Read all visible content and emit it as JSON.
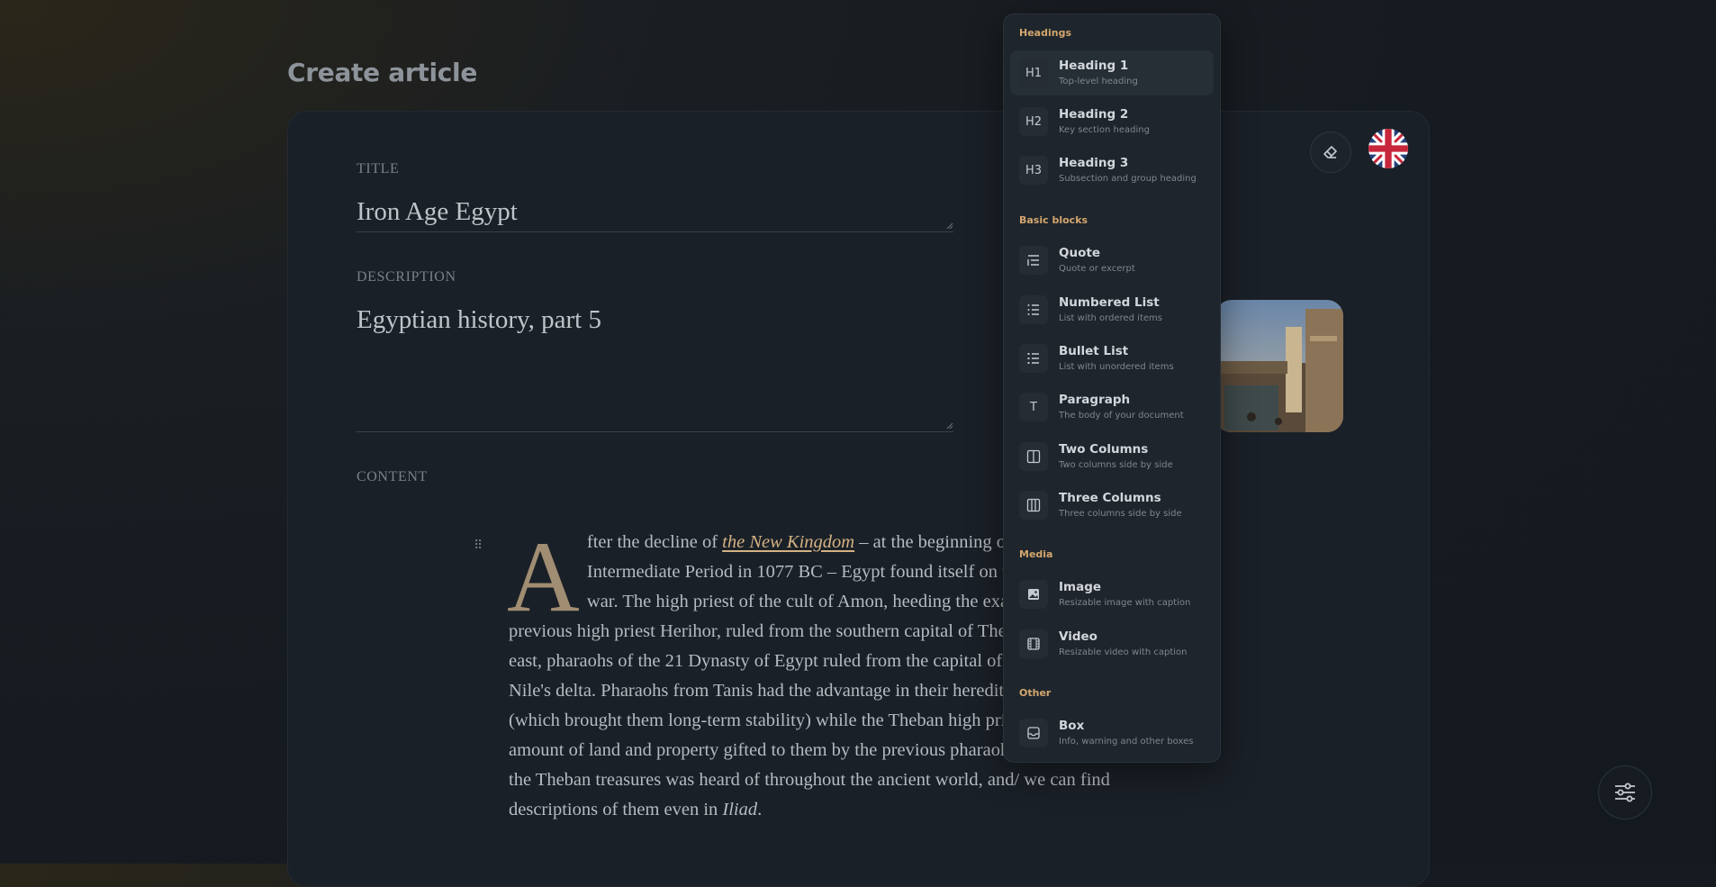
{
  "page": {
    "title": "Create article"
  },
  "form": {
    "title_label": "TITLE",
    "title_value": "Iron Age Egypt",
    "description_label": "DESCRIPTION",
    "description_value": "Egyptian history, part 5",
    "content_label": "CONTENT"
  },
  "toolbar": {
    "eraser_icon": "eraser-icon",
    "language_icon": "uk-flag-icon",
    "settings_icon": "sliders-icon"
  },
  "content": {
    "dropcap": "A",
    "p1": "fter the decline of ",
    "link": "the New Kingdom",
    "p2": " – at the beginning of the Third Intermediate Period in 1077 BC – Egypt found itself on the verge of civil war. The high priest of the cult of Amon, heeding the example of the previous high priest Herihor, ruled from the southern capital of Thebes, while in the east, pharaohs of the 21 Dynasty of Egypt ruled from the capital of Tanis in the Nile's delta. Pharaohs from Tanis had the advantage in their hereditary legitimacy (which brought them long-term stability) while the Theban high priests had a vast amount of land and property gifted to them by the previous pharaohs. The fame of the Theban treasures was heard of throughout the ancient world, and/ we can find descriptions of them even in ",
    "em": "Iliad",
    "p3": "."
  },
  "menu": {
    "groups": {
      "headings": "Headings",
      "basic": "Basic blocks",
      "media": "Media",
      "other": "Other"
    },
    "items": [
      {
        "icon": "H1",
        "title": "Heading 1",
        "desc": "Top-level heading"
      },
      {
        "icon": "H2",
        "title": "Heading 2",
        "desc": "Key section heading"
      },
      {
        "icon": "H3",
        "title": "Heading 3",
        "desc": "Subsection and group heading"
      },
      {
        "icon": "quote-icon",
        "title": "Quote",
        "desc": "Quote or excerpt"
      },
      {
        "icon": "numbered-list-icon",
        "title": "Numbered List",
        "desc": "List with ordered items"
      },
      {
        "icon": "bullet-list-icon",
        "title": "Bullet List",
        "desc": "List with unordered items"
      },
      {
        "icon": "T",
        "title": "Paragraph",
        "desc": "The body of your document"
      },
      {
        "icon": "two-columns-icon",
        "title": "Two Columns",
        "desc": "Two columns side by side"
      },
      {
        "icon": "three-columns-icon",
        "title": "Three Columns",
        "desc": "Three columns side by side"
      },
      {
        "icon": "image-icon",
        "title": "Image",
        "desc": "Resizable image with caption"
      },
      {
        "icon": "video-icon",
        "title": "Video",
        "desc": "Resizable video with caption"
      },
      {
        "icon": "box-icon",
        "title": "Box",
        "desc": "Info, warning and other boxes"
      }
    ]
  }
}
